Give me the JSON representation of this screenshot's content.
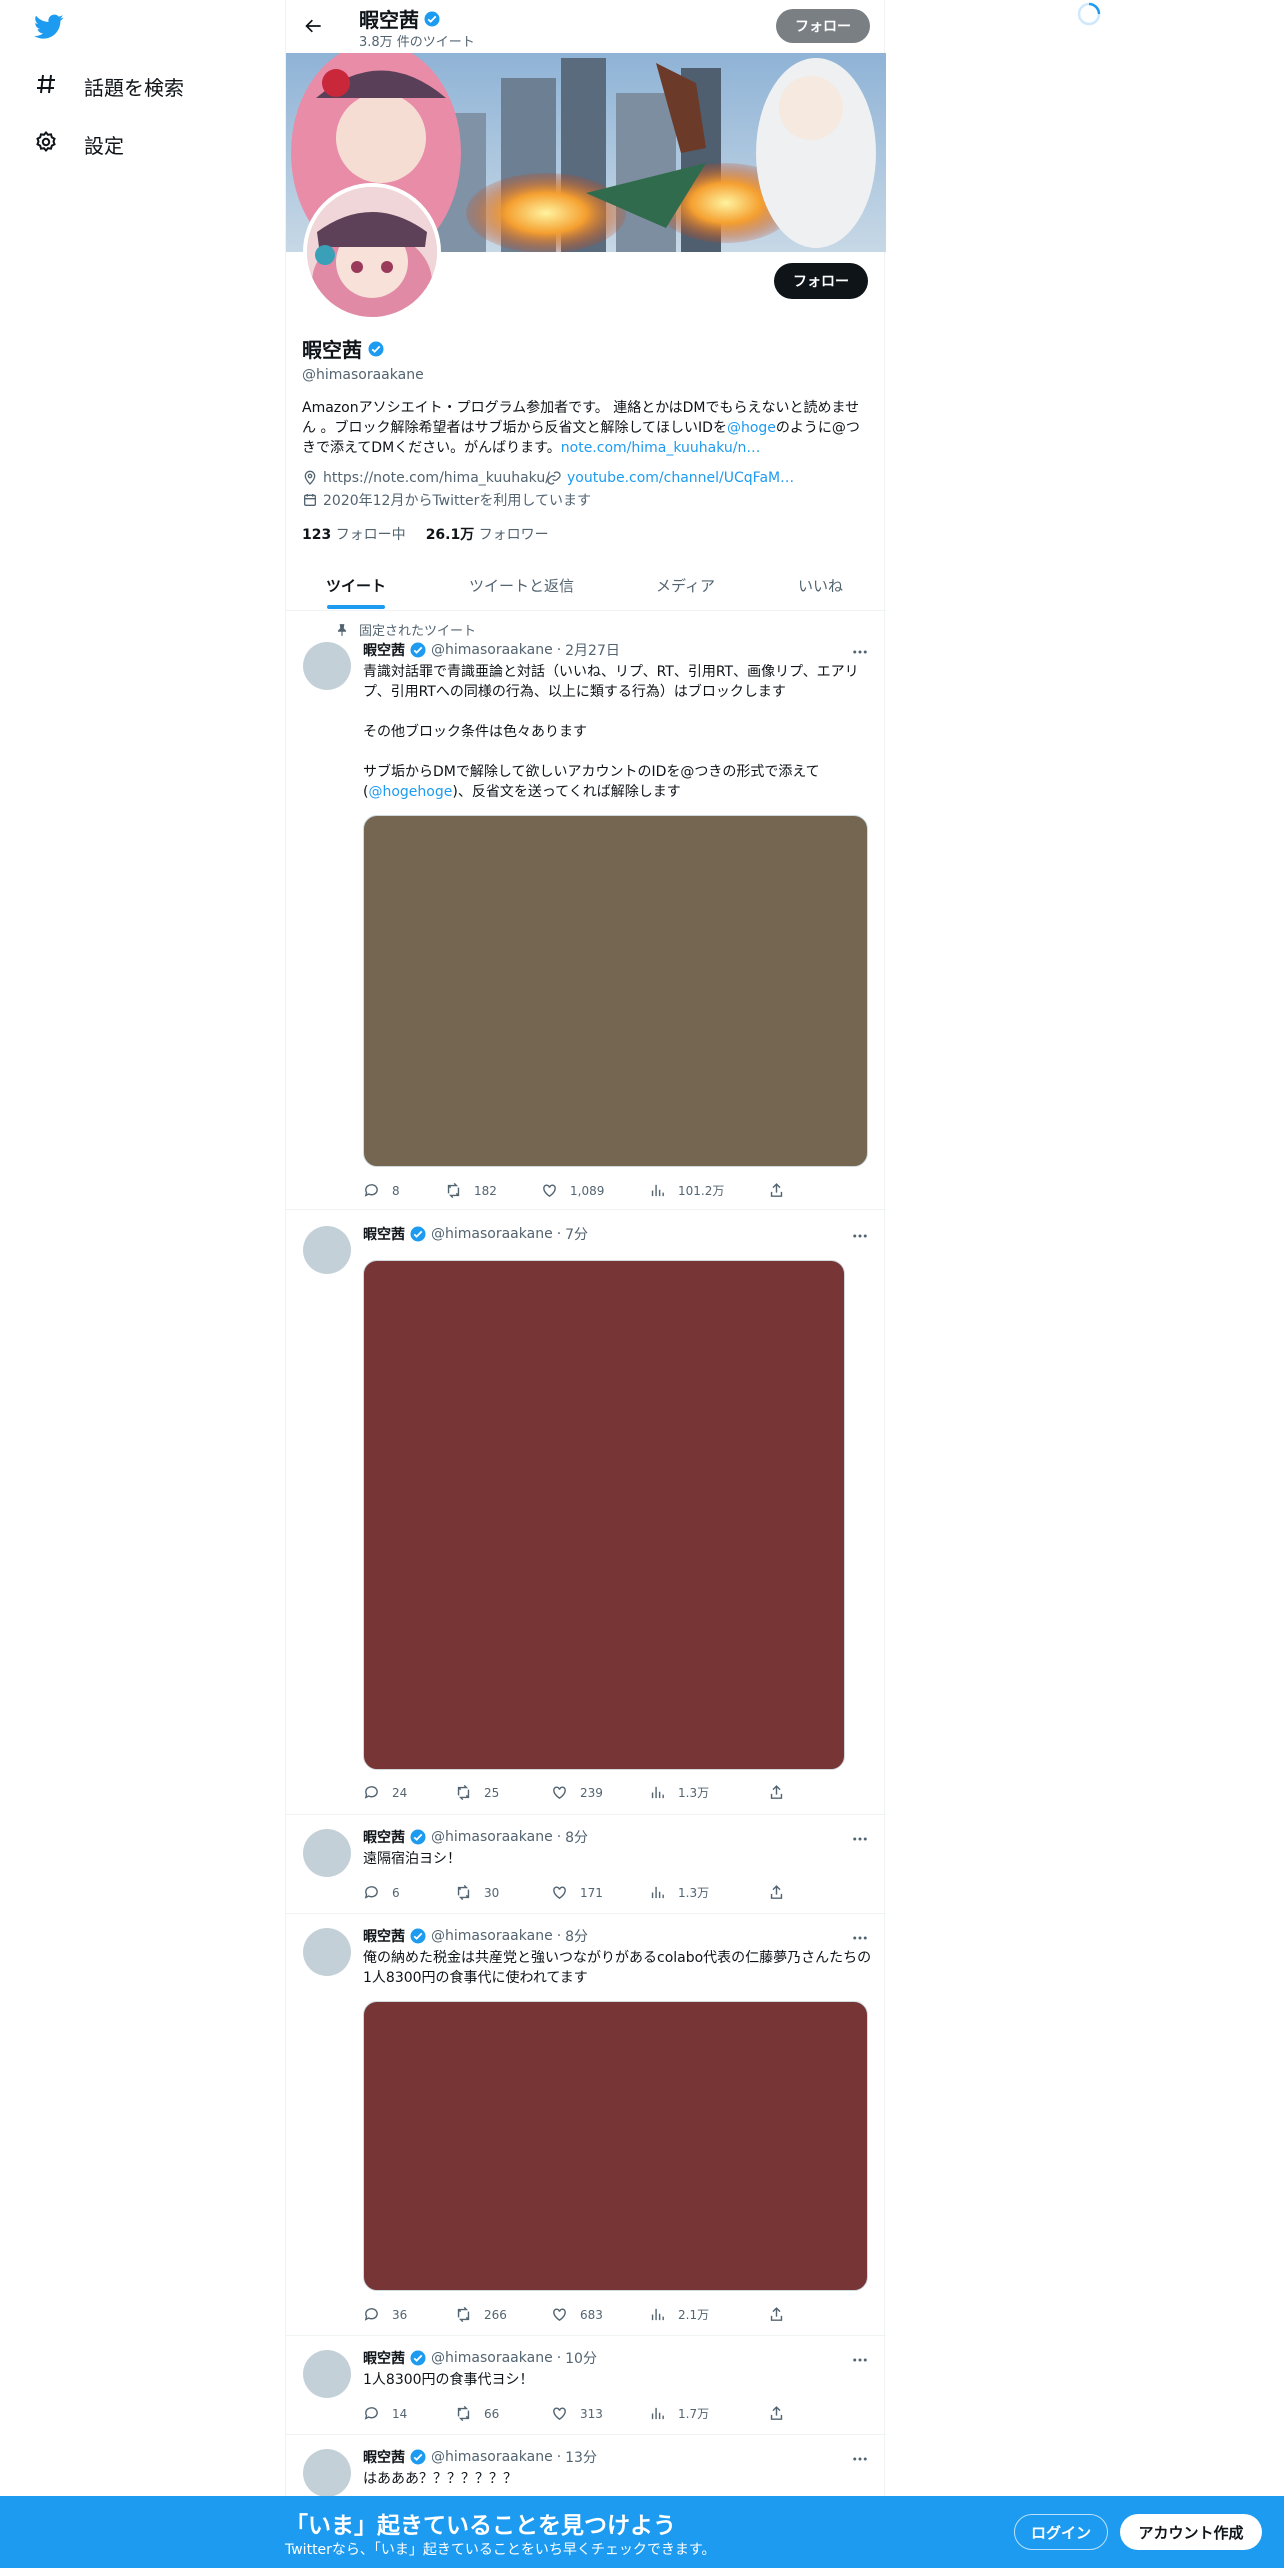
{
  "nav": {
    "items": [
      {
        "label": "話題を検索",
        "icon": "hashtag-icon"
      },
      {
        "label": "設定",
        "icon": "gear-icon"
      }
    ]
  },
  "header": {
    "name": "暇空茜",
    "tweet_count": "3.8万 件のツイート",
    "follow_label": "フォロー"
  },
  "profile": {
    "name": "暇空茜",
    "handle": "@himasoraakane",
    "follow_label": "フォロー",
    "bio_1": "Amazonアソシエイト・プログラム参加者です。 連絡とかはDMでもらえないと読めません 。ブロック解除希望者はサブ垢から反省文と解除してほしいIDを",
    "bio_mention": "@hoge",
    "bio_2": "のように@つきで添えてDMください。がんばります。",
    "bio_link": "note.com/hima_kuuhaku/n…",
    "location": "https://note.com/hima_kuuhaku/",
    "website": "youtube.com/channel/UCqFaM…",
    "joined": "2020年12月からTwitterを利用しています",
    "following_count": "123",
    "following_label": "フォロー中",
    "followers_count": "26.1万",
    "followers_label": "フォロワー"
  },
  "tabs": [
    {
      "label": "ツイート",
      "active": true
    },
    {
      "label": "ツイートと返信",
      "active": false
    },
    {
      "label": "メディア",
      "active": false
    },
    {
      "label": "いいね",
      "active": false
    }
  ],
  "pinned_label": "固定されたツイート",
  "tweets": [
    {
      "name": "暇空茜",
      "handle": "@himasoraakane",
      "time": "2月27日",
      "text_1": "青識対話罪で青識亜論と対話（いいね、リプ、RT、引用RT、画像リプ、エアリプ、引用RTへの同様の行為、以上に類する行為）はブロックします",
      "text_2": "その他ブロック条件は色々あります",
      "text_3": "サブ垢からDMで解除して欲しいアカウントのIDを@つきの形式で添えて(",
      "text_mention": "@hogehoge",
      "text_4": ")、反省文を送ってくれば解除します",
      "media_color": "#756652",
      "replies": "8",
      "retweets": "182",
      "likes": "1,089",
      "views": "101.2万"
    },
    {
      "name": "暇空茜",
      "handle": "@himasoraakane",
      "time": "7分",
      "media_color": "#773535",
      "replies": "24",
      "retweets": "25",
      "likes": "239",
      "views": "1.3万"
    },
    {
      "name": "暇空茜",
      "handle": "@himasoraakane",
      "time": "8分",
      "text": "遠隔宿泊ヨシ！",
      "replies": "6",
      "retweets": "30",
      "likes": "171",
      "views": "1.3万"
    },
    {
      "name": "暇空茜",
      "handle": "@himasoraakane",
      "time": "8分",
      "text": "俺の納めた税金は共産党と強いつながりがあるcolabo代表の仁藤夢乃さんたちの1人8300円の食事代に使われてます",
      "media_color": "#773535",
      "replies": "36",
      "retweets": "266",
      "likes": "683",
      "views": "2.1万"
    },
    {
      "name": "暇空茜",
      "handle": "@himasoraakane",
      "time": "10分",
      "text": "1人8300円の食事代ヨシ！",
      "replies": "14",
      "retweets": "66",
      "likes": "313",
      "views": "1.7万"
    },
    {
      "name": "暇空茜",
      "handle": "@himasoraakane",
      "time": "13分",
      "text": "はあああ？？？？？？？"
    }
  ],
  "bottom_bar": {
    "title": "「いま」起きていることを見つけよう",
    "subtitle": "Twitterなら、「いま」起きていることをいち早くチェックできます。",
    "login_label": "ログイン",
    "signup_label": "アカウント作成"
  },
  "colors": {
    "accent": "#1d9bf0",
    "verified": "#1d9bf0"
  }
}
